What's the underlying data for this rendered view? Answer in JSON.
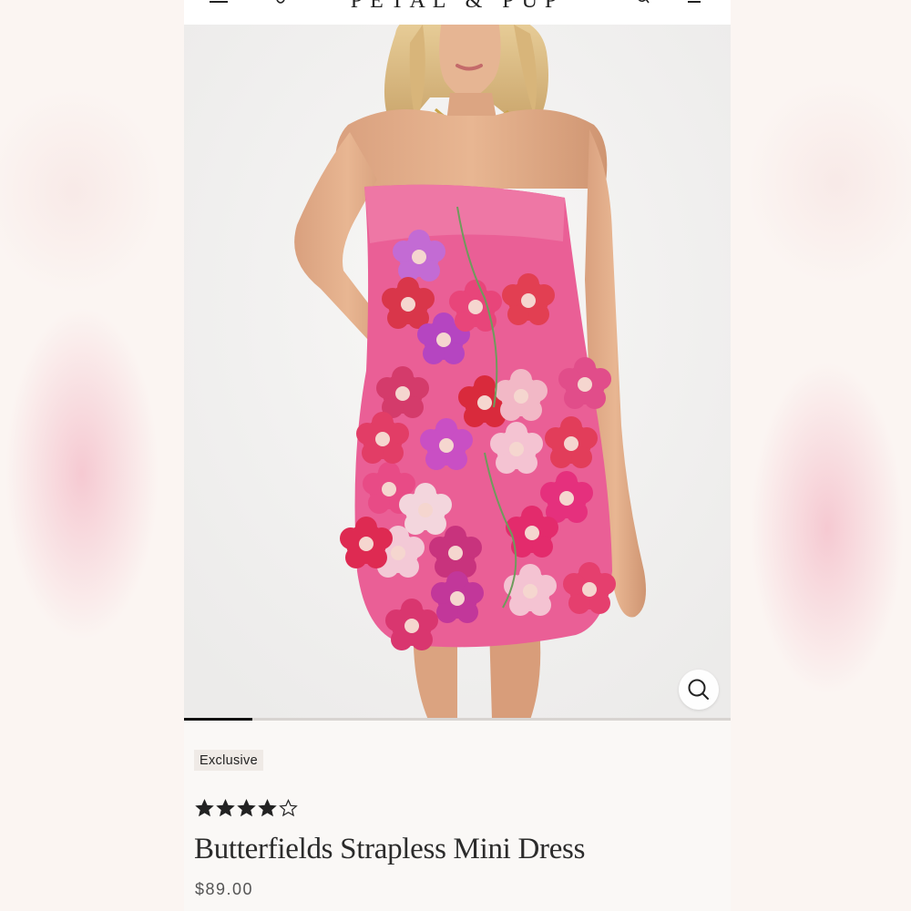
{
  "header": {
    "brand": "PETAL & PUP",
    "menu_icon": "hamburger-menu-icon",
    "account_icon": "user-icon",
    "search_icon": "search-icon",
    "cart_icon": "bag-icon"
  },
  "gallery": {
    "image_alt_icon": "product-photo",
    "zoom_icon": "zoom-search-icon",
    "progress": 0.125
  },
  "product": {
    "badge": "Exclusive",
    "rating": 4,
    "rating_max": 5,
    "title": "Butterfields Strapless Mini Dress",
    "price": "$89.00"
  },
  "colors": {
    "accent": "#111111",
    "dress_pink": "#ea5f96",
    "badge_bg": "#efeae6"
  }
}
